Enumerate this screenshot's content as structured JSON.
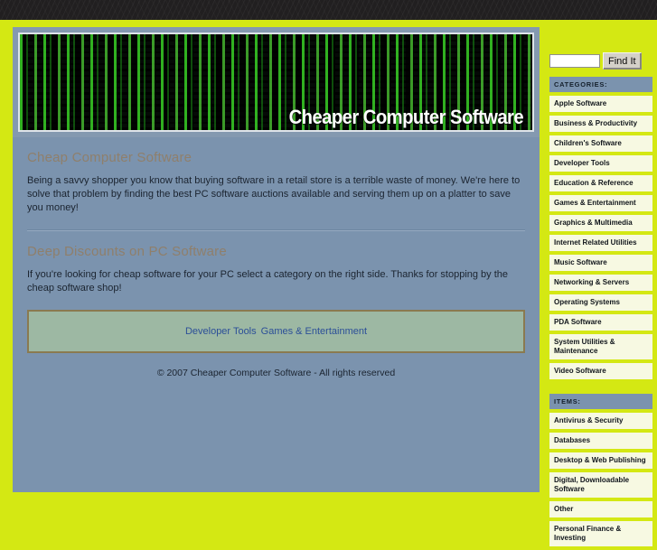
{
  "banner": {
    "title": "Cheaper Computer Software",
    "image_name": "matrix-digital-rain-banner"
  },
  "search": {
    "value": "",
    "placeholder": "",
    "button_label": "Find It"
  },
  "main": {
    "section1": {
      "heading": "Cheap Computer Software",
      "body": "Being a savvy shopper you know that buying software in a retail store is a terrible waste of money. We're here to solve that problem by finding the best PC software auctions available and serving them up on a platter to save you money!"
    },
    "section2": {
      "heading": "Deep Discounts on PC Software",
      "body": "If you're looking for cheap software for your PC select a category on the right side. Thanks for stopping by the cheap software shop!"
    },
    "promo_links": [
      "Developer Tools",
      "Games & Entertainment"
    ],
    "footer": "© 2007 Cheaper Computer Software - All rights reserved"
  },
  "sidebar": {
    "categories_header": "CATEGORIES:",
    "categories": [
      "Apple Software",
      "Business & Productivity",
      "Children's Software",
      "Developer Tools",
      "Education & Reference",
      "Games & Entertainment",
      "Graphics & Multimedia",
      "Internet Related Utilities",
      "Music Software",
      "Networking & Servers",
      "Operating Systems",
      "PDA Software",
      "System Utilities & Maintenance",
      "Video Software"
    ],
    "items_header": "ITEMS:",
    "items": [
      "Antivirus & Security",
      "Databases",
      "Desktop & Web Publishing",
      "Digital, Downloadable Software",
      "Other",
      "Personal Finance & Investing"
    ]
  },
  "colors": {
    "page_background": "#d4e813",
    "content_panel": "#7b93ae",
    "sidebar_item": "#f7f9e2",
    "promo_box": "#9db8a3",
    "promo_border": "#8a7a50",
    "link": "#2c4f98",
    "heading": "#8f7f6b",
    "top_strip": "#211f20"
  }
}
